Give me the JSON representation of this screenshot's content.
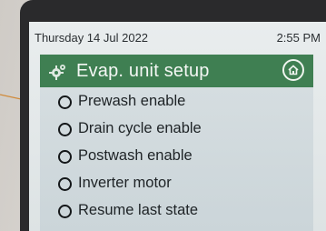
{
  "status": {
    "date": "Thursday 14 Jul 2022",
    "time": "2:55 PM"
  },
  "header": {
    "title": "Evap. unit setup",
    "left_icon": "gear-icon",
    "right_icon": "home-icon"
  },
  "menu": {
    "items": [
      {
        "label": "Prewash enable",
        "selected": false
      },
      {
        "label": "Drain cycle enable",
        "selected": false
      },
      {
        "label": "Postwash enable",
        "selected": false
      },
      {
        "label": "Inverter motor",
        "selected": false
      },
      {
        "label": "Resume last state",
        "selected": false
      }
    ]
  },
  "colors": {
    "header": "#3f7f52",
    "bezel": "#2a2a2c",
    "callout_line": "#d08a3a"
  }
}
